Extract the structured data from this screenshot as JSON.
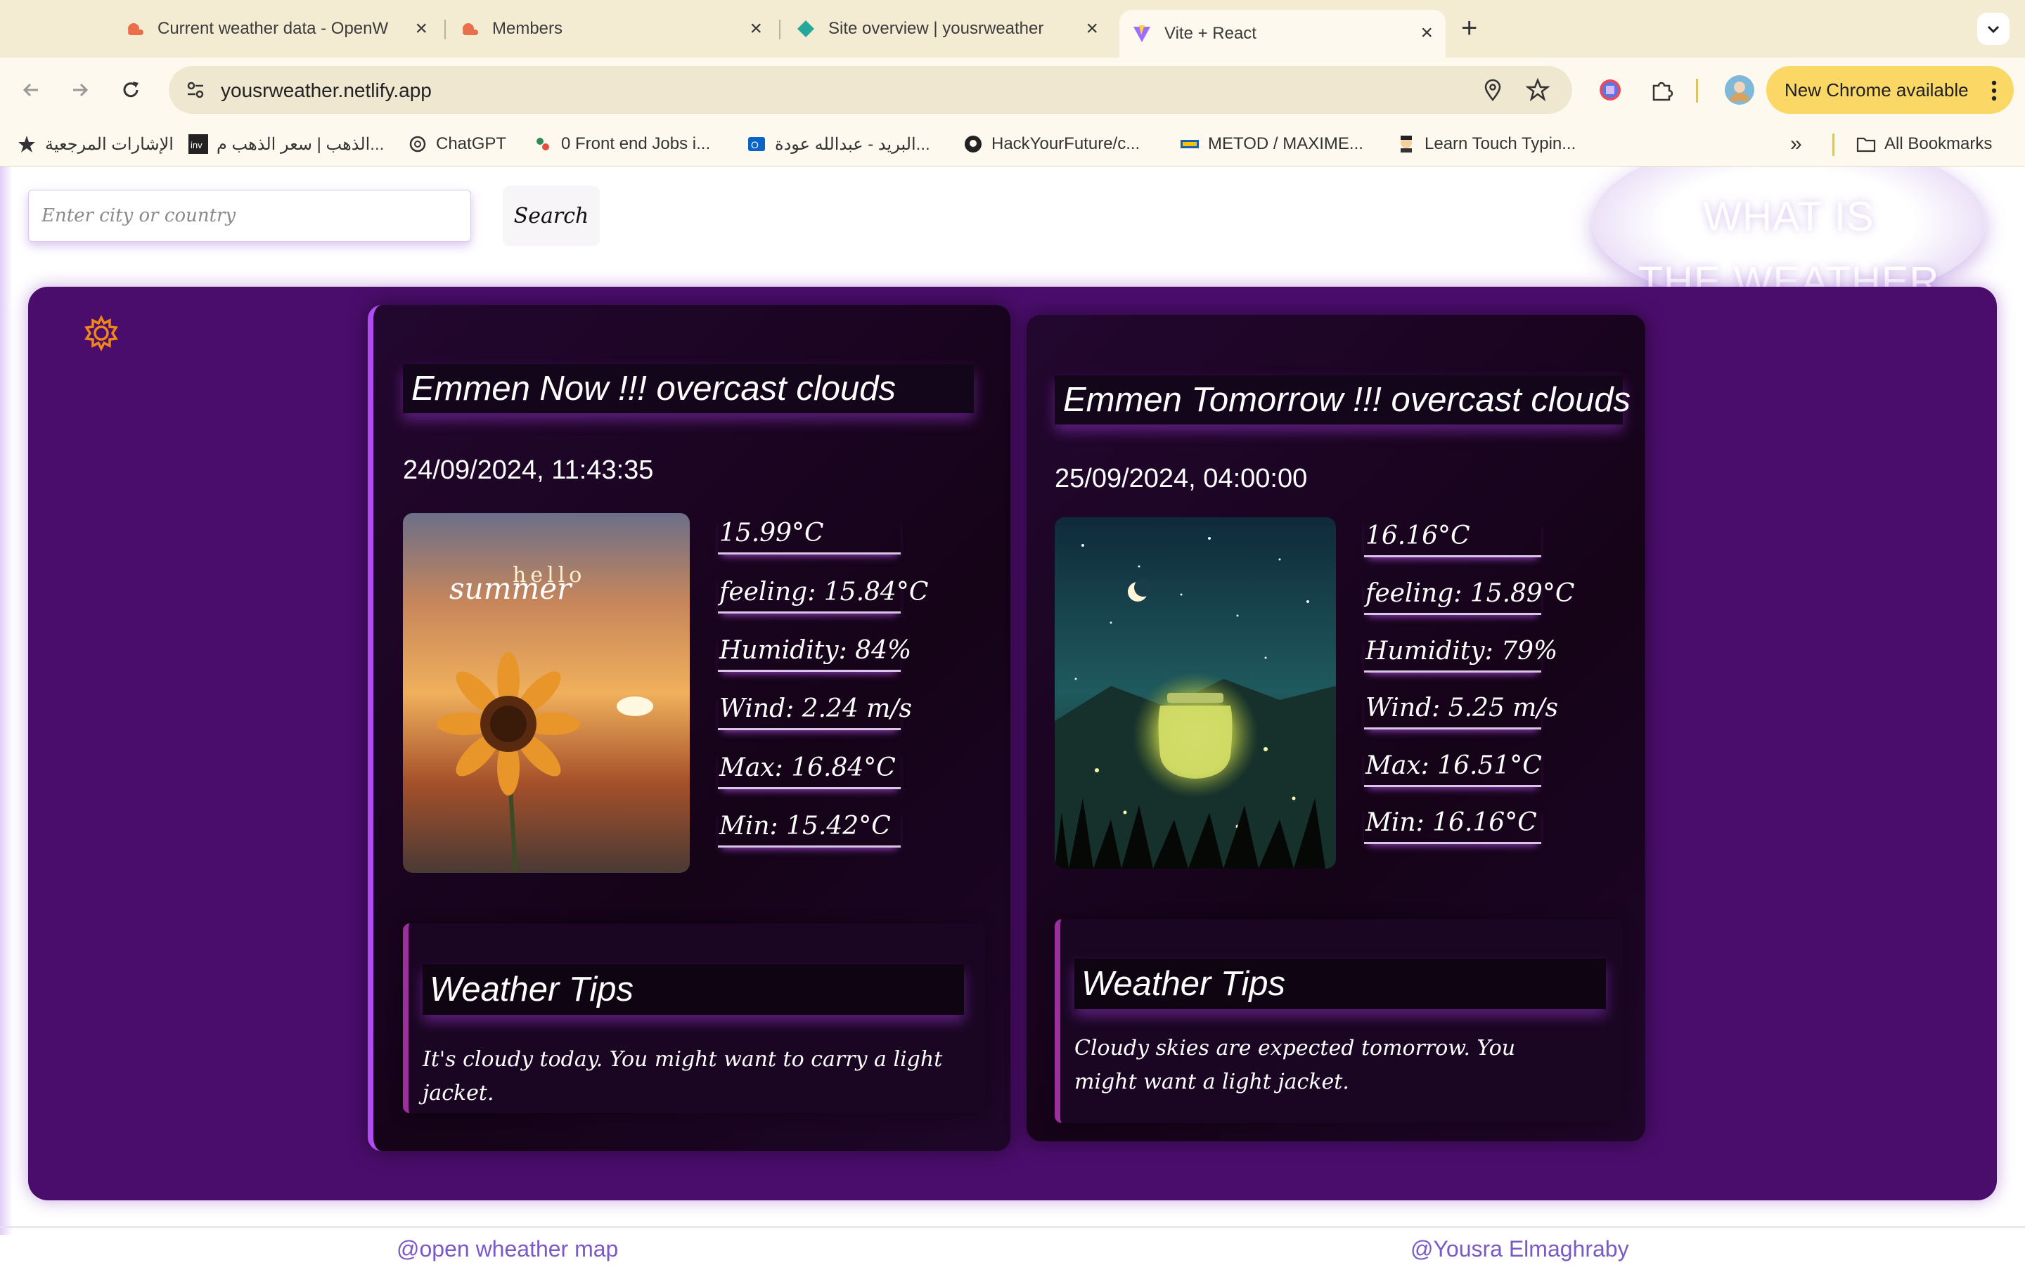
{
  "browser": {
    "tabs": [
      {
        "title": "Current weather data - OpenW",
        "active": false
      },
      {
        "title": "Members",
        "active": false
      },
      {
        "title": "Site overview | yousrweather",
        "active": false
      },
      {
        "title": "Vite + React",
        "active": true
      }
    ],
    "new_tab_symbol": "+",
    "url": "yousrweather.netlify.app",
    "new_chrome_label": "New Chrome available",
    "bookmarks": [
      "الإشارات المرجعية",
      "الذهب | سعر الذهب م...",
      "ChatGPT",
      "0 Front end Jobs i...",
      "البريد - عبدالله عودة...",
      "HackYourFuture/c...",
      "METOD / MAXIME...",
      "Learn Touch Typin..."
    ],
    "more_bookmarks": "»",
    "all_bookmarks_label": "All Bookmarks"
  },
  "search": {
    "placeholder": "Enter city or country",
    "button_label": "Search"
  },
  "header_badge": {
    "line1": "WHAT IS",
    "line2": "THE WEATHER"
  },
  "today": {
    "title": "Emmen Now !!! overcast clouds",
    "datetime": "24/09/2024, 11:43:35",
    "image_caption_1": "hello",
    "image_caption_2": "summer",
    "stats": [
      "15.99°C",
      "feeling: 15.84°C",
      "Humidity: 84%",
      "Wind: 2.24 m/s",
      "Max: 16.84°C",
      "Min: 15.42°C"
    ],
    "tips_title": "Weather Tips",
    "tips_text": "It's cloudy today. You might want to carry a light jacket."
  },
  "tomorrow": {
    "title": "Emmen Tomorrow !!! overcast clouds",
    "datetime": "25/09/2024, 04:00:00",
    "stats": [
      "16.16°C",
      "feeling: 15.89°C",
      "Humidity: 79%",
      "Wind: 5.25 m/s",
      "Max: 16.51°C",
      "Min: 16.16°C"
    ],
    "tips_title": "Weather Tips",
    "tips_text": "Cloudy skies are expected tomorrow. You might want a light jacket."
  },
  "footer": {
    "left_link": "@open wheather map",
    "right_link": "@Yousra Elmaghraby"
  },
  "colors": {
    "panel": "#4b0d6c",
    "card": "#1a0622",
    "accent": "#b04cf0",
    "link": "#7a59c8",
    "chrome_update": "#fbd866"
  },
  "icons": [
    "back-icon",
    "forward-icon",
    "reload-icon",
    "site-info-icon",
    "location-icon",
    "star-icon",
    "extension-icon",
    "profile-avatar",
    "menu-dots-icon",
    "folder-icon",
    "gear-icon"
  ]
}
